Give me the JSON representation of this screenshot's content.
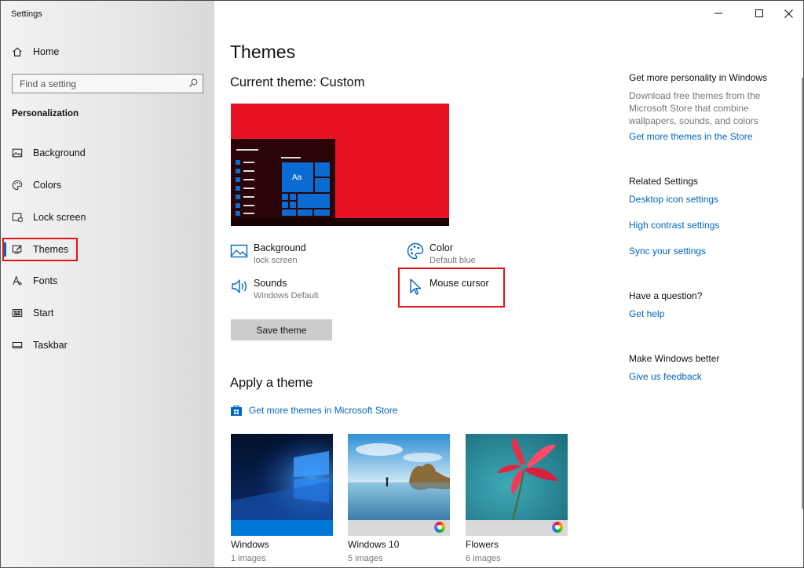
{
  "app": {
    "title": "Settings"
  },
  "window_controls": {
    "minimize": "─",
    "maximize": "☐",
    "close": "✕"
  },
  "sidebar": {
    "home": "Home",
    "search_placeholder": "Find a setting",
    "section": "Personalization",
    "items": [
      {
        "label": "Background",
        "icon": "picture-icon"
      },
      {
        "label": "Colors",
        "icon": "palette-icon"
      },
      {
        "label": "Lock screen",
        "icon": "lock-screen-icon"
      },
      {
        "label": "Themes",
        "icon": "themes-icon",
        "active": true
      },
      {
        "label": "Fonts",
        "icon": "fonts-icon"
      },
      {
        "label": "Start",
        "icon": "start-icon"
      },
      {
        "label": "Taskbar",
        "icon": "taskbar-icon"
      }
    ],
    "active_color": "#0067c0"
  },
  "main": {
    "title": "Themes",
    "current_theme": "Current theme: Custom",
    "preview": {
      "tile_text": "Aa",
      "accent": "#e81123",
      "tile_color": "#0a6cd2"
    },
    "options": {
      "background": {
        "title": "Background",
        "subtitle": "lock screen"
      },
      "color": {
        "title": "Color",
        "subtitle": "Default blue"
      },
      "sounds": {
        "title": "Sounds",
        "subtitle": "Windows Default"
      },
      "mouse": {
        "title": "Mouse cursor"
      }
    },
    "save_button": "Save theme",
    "apply_title": "Apply a theme",
    "store_link": "Get more themes in Microsoft Store",
    "themes": [
      {
        "name": "Windows",
        "count": "1 images"
      },
      {
        "name": "Windows 10",
        "count": "5 images"
      },
      {
        "name": "Flowers",
        "count": "6 images"
      }
    ]
  },
  "right_panel": {
    "personality": {
      "heading": "Get more personality in Windows",
      "text": "Download free themes from the Microsoft Store that combine wallpapers, sounds, and colors",
      "link": "Get more themes in the Store"
    },
    "related": {
      "heading": "Related Settings",
      "links": [
        "Desktop icon settings",
        "High contrast settings",
        "Sync your settings"
      ]
    },
    "question": {
      "heading": "Have a question?",
      "link": "Get help"
    },
    "better": {
      "heading": "Make Windows better",
      "link": "Give us feedback"
    }
  },
  "highlight_color": "#e5141b",
  "link_color": "#0067c0"
}
